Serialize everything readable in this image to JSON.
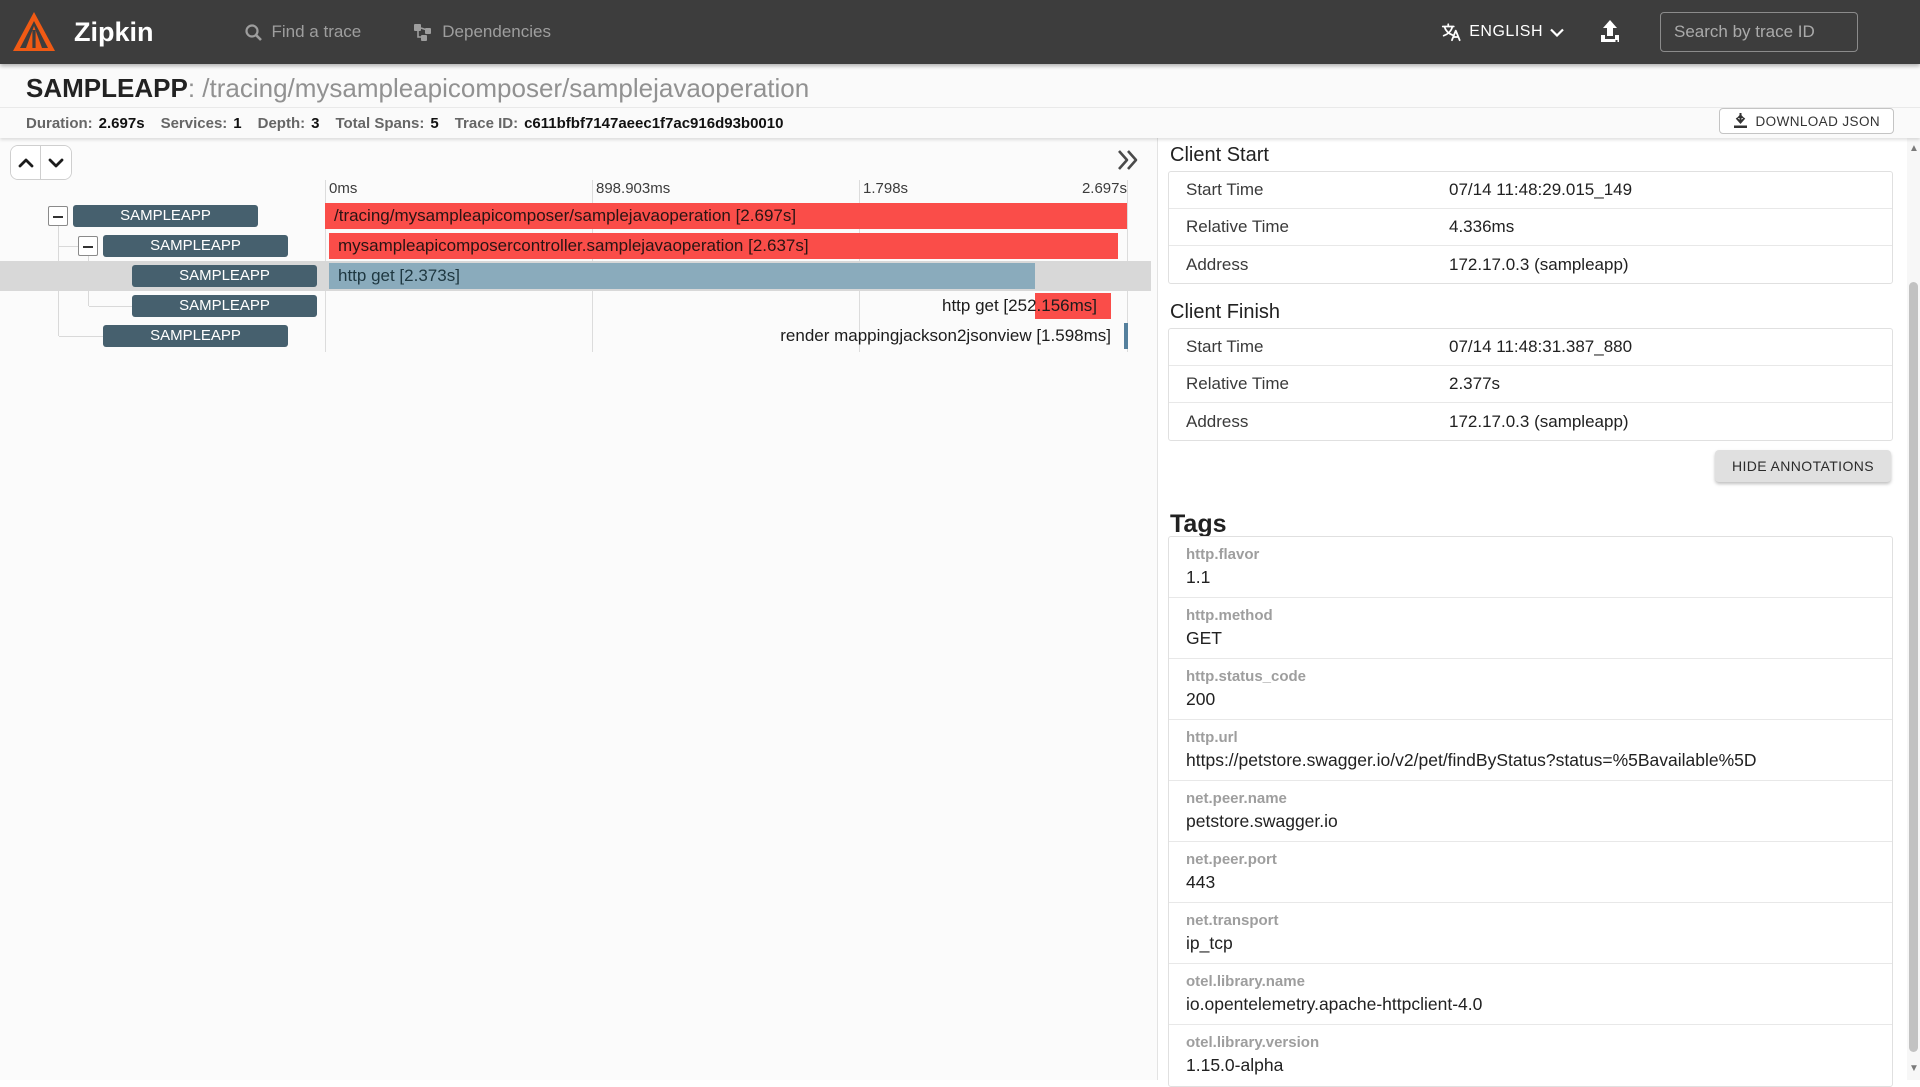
{
  "nav": {
    "brand": "Zipkin",
    "find_a_trace": "Find a trace",
    "dependencies": "Dependencies",
    "language": "ENGLISH",
    "search_placeholder": "Search by trace ID"
  },
  "trace": {
    "service": "SAMPLEAPP",
    "separator": ": ",
    "operation": "/tracing/mysampleapicomposer/samplejavaoperation",
    "stats": [
      {
        "label": "Duration:",
        "value": "2.697s"
      },
      {
        "label": "Services:",
        "value": "1"
      },
      {
        "label": "Depth:",
        "value": "3"
      },
      {
        "label": "Total Spans:",
        "value": "5"
      },
      {
        "label": "Trace ID:",
        "value": "c611bfbf7147aeec1f7ac916d93b0010"
      }
    ],
    "download_json_label": "DOWNLOAD JSON"
  },
  "timeline": {
    "ticks": [
      "0ms",
      "898.903ms",
      "1.798s",
      "2.697s"
    ],
    "spans": [
      {
        "service": "SAMPLEAPP",
        "label": "/tracing/mysampleapicomposer/samplejavaoperation [2.697s]"
      },
      {
        "service": "SAMPLEAPP",
        "label": "mysampleapicomposercontroller.samplejavaoperation [2.637s]"
      },
      {
        "service": "SAMPLEAPP",
        "label": "http get [2.373s]"
      },
      {
        "service": "SAMPLEAPP",
        "label": "http get [252.156ms]"
      },
      {
        "service": "SAMPLEAPP",
        "label": "render mappingjackson2jsonview [1.598ms]"
      }
    ]
  },
  "details": {
    "sections": [
      {
        "title": "Client Start",
        "rows": [
          [
            "Start Time",
            "07/14 11:48:29.015_149"
          ],
          [
            "Relative Time",
            "4.336ms"
          ],
          [
            "Address",
            "172.17.0.3 (sampleapp)"
          ]
        ]
      },
      {
        "title": "Client Finish",
        "rows": [
          [
            "Start Time",
            "07/14 11:48:31.387_880"
          ],
          [
            "Relative Time",
            "2.377s"
          ],
          [
            "Address",
            "172.17.0.3 (sampleapp)"
          ]
        ]
      }
    ],
    "hide_annotations_label": "HIDE ANNOTATIONS",
    "tags_title": "Tags",
    "tags": [
      {
        "key": "http.flavor",
        "value": "1.1"
      },
      {
        "key": "http.method",
        "value": "GET"
      },
      {
        "key": "http.status_code",
        "value": "200"
      },
      {
        "key": "http.url",
        "value": "https://petstore.swagger.io/v2/pet/findByStatus?status=%5Bavailable%5D"
      },
      {
        "key": "net.peer.name",
        "value": "petstore.swagger.io"
      },
      {
        "key": "net.peer.port",
        "value": "443"
      },
      {
        "key": "net.transport",
        "value": "ip_tcp"
      },
      {
        "key": "otel.library.name",
        "value": "io.opentelemetry.apache-httpclient-4.0"
      },
      {
        "key": "otel.library.version",
        "value": "1.15.0-alpha"
      }
    ]
  },
  "colors": {
    "navbar": "#3d3d3d",
    "logo_orange": "#f05a14",
    "span_red": "#fa4d49",
    "span_blue": "#8aabbc",
    "service_badge": "#46606e",
    "row_highlight": "#d8d8d8"
  }
}
